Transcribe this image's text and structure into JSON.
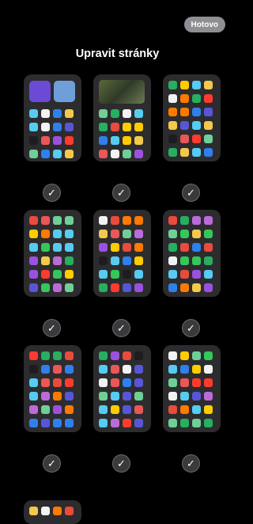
{
  "header": {
    "done_label": "Hotovo",
    "title": "Upravit stránky"
  },
  "pages": [
    {
      "name": "page-1",
      "selected": true,
      "check_glyph": "✓"
    },
    {
      "name": "page-2",
      "selected": true,
      "check_glyph": "✓"
    },
    {
      "name": "page-3",
      "selected": true,
      "check_glyph": "✓"
    },
    {
      "name": "page-4",
      "selected": true,
      "check_glyph": "✓"
    },
    {
      "name": "page-5",
      "selected": true,
      "check_glyph": "✓"
    },
    {
      "name": "page-6",
      "selected": true,
      "check_glyph": "✓"
    },
    {
      "name": "page-7",
      "selected": true,
      "check_glyph": "✓"
    },
    {
      "name": "page-8",
      "selected": true,
      "check_glyph": "✓"
    },
    {
      "name": "page-9",
      "selected": true,
      "check_glyph": "✓"
    }
  ],
  "colors": {
    "background": "#000000",
    "page_tile": "#2c2c2e",
    "done_button": "#8e8e93",
    "check_circle": "#3a3a3c"
  },
  "icon_palette": [
    "#e94b3c",
    "#2f80ed",
    "#27ae60",
    "#f2c94c",
    "#9b51e0",
    "#ff7a00",
    "#eb5757",
    "#56ccf2",
    "#f2f2f2",
    "#1d1d1f",
    "#6fcf97",
    "#bb6bd9",
    "#ff3b30",
    "#34c759",
    "#5856d6",
    "#ffcc00"
  ]
}
